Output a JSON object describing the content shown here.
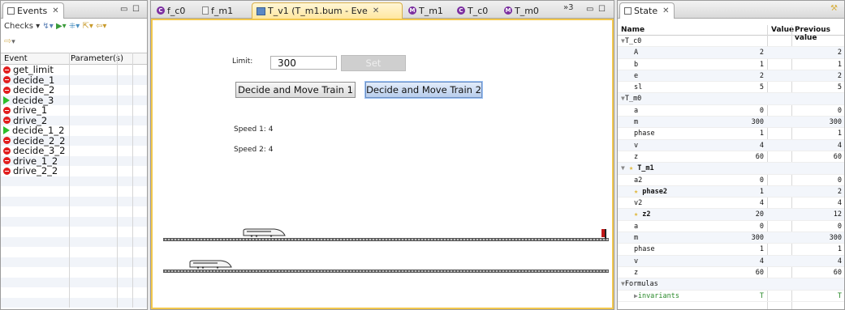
{
  "events_view": {
    "tab_label": "Events",
    "toolbar_checks": "Checks ▾",
    "columns": [
      "Event",
      "Parameter(s)"
    ],
    "events": [
      {
        "name": "get_limit",
        "enabled": false
      },
      {
        "name": "decide_1",
        "enabled": false
      },
      {
        "name": "decide_2",
        "enabled": false
      },
      {
        "name": "decide_3",
        "enabled": true
      },
      {
        "name": "drive_1",
        "enabled": false
      },
      {
        "name": "drive_2",
        "enabled": false
      },
      {
        "name": "decide_1_2",
        "enabled": true
      },
      {
        "name": "decide_2_2",
        "enabled": false
      },
      {
        "name": "decide_3_2",
        "enabled": false
      },
      {
        "name": "drive_1_2",
        "enabled": false
      },
      {
        "name": "drive_2_2",
        "enabled": false
      }
    ]
  },
  "editor": {
    "tabs": [
      {
        "label": "f_c0",
        "icon": "C"
      },
      {
        "label": "f_m1",
        "icon": "file"
      },
      {
        "label": "T_v1 (T_m1.bum - Eve",
        "icon": "vis",
        "active": true
      },
      {
        "label": "T_m1",
        "icon": "M"
      },
      {
        "label": "T_c0",
        "icon": "C"
      },
      {
        "label": "T_m0",
        "icon": "M"
      }
    ],
    "overflow": "»3",
    "limit_label": "Limit:",
    "limit_value": "300",
    "set_button": "Set",
    "train1_button": "Decide and Move Train 1",
    "train2_button": "Decide and Move Train 2",
    "speed1": "Speed 1: 4",
    "speed2": "Speed 2: 4"
  },
  "state_view": {
    "tab_label": "State",
    "columns": [
      "Name",
      "Value",
      "Previous value"
    ],
    "rows": [
      {
        "name": "T_c0",
        "value": "",
        "prev": "",
        "indent": 0,
        "group": true
      },
      {
        "name": "A",
        "value": "2",
        "prev": "2",
        "indent": 1
      },
      {
        "name": "b",
        "value": "1",
        "prev": "1",
        "indent": 1
      },
      {
        "name": "e",
        "value": "2",
        "prev": "2",
        "indent": 1
      },
      {
        "name": "sl",
        "value": "5",
        "prev": "5",
        "indent": 1
      },
      {
        "name": "T_m0",
        "value": "",
        "prev": "",
        "indent": 0,
        "group": true
      },
      {
        "name": "a",
        "value": "0",
        "prev": "0",
        "indent": 1
      },
      {
        "name": "m",
        "value": "300",
        "prev": "300",
        "indent": 1
      },
      {
        "name": "phase",
        "value": "1",
        "prev": "1",
        "indent": 1
      },
      {
        "name": "v",
        "value": "4",
        "prev": "4",
        "indent": 1
      },
      {
        "name": "z",
        "value": "60",
        "prev": "60",
        "indent": 1
      },
      {
        "name": "T_m1",
        "value": "",
        "prev": "",
        "indent": 0,
        "group": true,
        "star": true
      },
      {
        "name": "a2",
        "value": "0",
        "prev": "0",
        "indent": 1
      },
      {
        "name": "phase2",
        "value": "1",
        "prev": "2",
        "indent": 1,
        "star": true
      },
      {
        "name": "v2",
        "value": "4",
        "prev": "4",
        "indent": 1
      },
      {
        "name": "z2",
        "value": "20",
        "prev": "12",
        "indent": 1,
        "star": true
      },
      {
        "name": "a",
        "value": "0",
        "prev": "0",
        "indent": 1
      },
      {
        "name": "m",
        "value": "300",
        "prev": "300",
        "indent": 1
      },
      {
        "name": "phase",
        "value": "1",
        "prev": "1",
        "indent": 1
      },
      {
        "name": "v",
        "value": "4",
        "prev": "4",
        "indent": 1
      },
      {
        "name": "z",
        "value": "60",
        "prev": "60",
        "indent": 1
      },
      {
        "name": "Formulas",
        "value": "",
        "prev": "",
        "indent": 0,
        "group": true
      },
      {
        "name": "invariants",
        "value": "T",
        "prev": "T",
        "indent": 1,
        "green": true,
        "collapsed": true
      }
    ]
  },
  "colors": {
    "editor_border": "#f2c74c",
    "disabled_event": "#e21d1d",
    "enabled_event": "#2cbf2c",
    "star": "#e0b73a"
  }
}
